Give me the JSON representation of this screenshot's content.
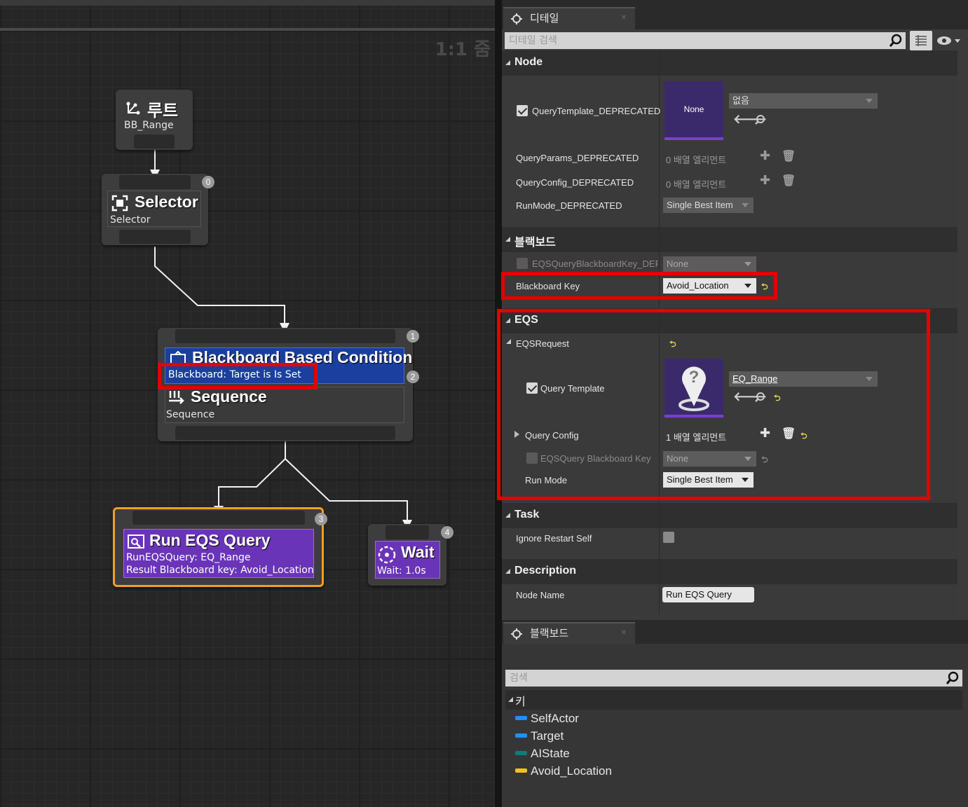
{
  "graph": {
    "zoom_label": "1:1 줌",
    "nodes": {
      "root": {
        "title": "루트",
        "subtitle": "BB_Range"
      },
      "selector": {
        "title": "Selector",
        "subtitle": "Selector",
        "index": "0"
      },
      "sequence": {
        "index": "1",
        "decorator_title": "Blackboard Based Condition",
        "decorator_subtitle": "Blackboard: Target is Is Set",
        "decorator_index": "2",
        "title": "Sequence",
        "subtitle": "Sequence"
      },
      "run_eqs": {
        "title": "Run EQS Query",
        "line1": "RunEQSQuery: EQ_Range",
        "line2": "Result Blackboard key: Avoid_Location",
        "index": "3"
      },
      "wait": {
        "title": "Wait",
        "subtitle": "Wait: 1.0s",
        "index": "4"
      }
    }
  },
  "details": {
    "tab_label": "디테일",
    "search_placeholder": "디테일 검색",
    "categories": {
      "node": {
        "label": "Node",
        "query_template": {
          "label": "QueryTemplate_DEPRECATED",
          "thumb": "None",
          "combo": "없음"
        },
        "query_params": {
          "label": "QueryParams_DEPRECATED",
          "value": "0 배열 엘리먼트"
        },
        "query_config": {
          "label": "QueryConfig_DEPRECATED",
          "value": "0 배열 엘리먼트"
        },
        "run_mode": {
          "label": "RunMode_DEPRECATED",
          "value": "Single Best Item"
        }
      },
      "blackboard": {
        "label": "블랙보드",
        "eqs_key_deprecated": {
          "label": "EQSQueryBlackboardKey_DEPI",
          "value": "None"
        },
        "blackboard_key": {
          "label": "Blackboard Key",
          "value": "Avoid_Location"
        }
      },
      "eqs": {
        "label": "EQS",
        "request": {
          "label": "EQSRequest"
        },
        "query_template": {
          "label": "Query Template",
          "value": "EQ_Range"
        },
        "query_config": {
          "label": "Query Config",
          "value": "1 배열 엘리먼트"
        },
        "eqs_bb_key": {
          "label": "EQSQuery Blackboard Key",
          "value": "None"
        },
        "run_mode": {
          "label": "Run Mode",
          "value": "Single Best Item"
        }
      },
      "task": {
        "label": "Task",
        "ignore_restart": {
          "label": "Ignore Restart Self"
        }
      },
      "description": {
        "label": "Description",
        "node_name": {
          "label": "Node Name",
          "value": "Run EQS Query"
        }
      }
    }
  },
  "blackboard_panel": {
    "tab_label": "블랙보드",
    "search_placeholder": "검색",
    "keys_header": "키",
    "keys": [
      {
        "name": "SelfActor",
        "color": "#1f8fff"
      },
      {
        "name": "Target",
        "color": "#1f8fff"
      },
      {
        "name": "AIState",
        "color": "#0a7f7a"
      },
      {
        "name": "Avoid_Location",
        "color": "#f2c21b"
      }
    ]
  },
  "colors": {
    "highlight_red": "#e60000",
    "decorator_blue": "#1a3f9e",
    "task_purple": "#6a34b8",
    "selected_orange": "#f0a020"
  }
}
